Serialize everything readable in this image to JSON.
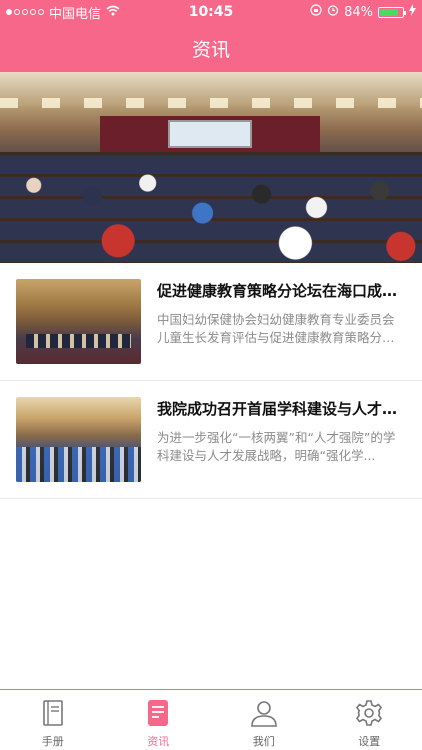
{
  "status_bar": {
    "carrier": "中国电信",
    "time": "10:45",
    "battery_percent": "84%",
    "battery_level": 0.84,
    "signal_dots_filled": 1,
    "signal_dots_total": 5
  },
  "nav": {
    "title": "资讯"
  },
  "banner": {
    "slide_count": 2,
    "active_slide": 1
  },
  "news": [
    {
      "title": "促进健康教育策略分论坛在海口成功...",
      "desc": "中国妇幼保健协会妇幼健康教育专业委员会儿童生长发育评估与促进健康教育策略分论...",
      "thumb": "conference-hall-photo"
    },
    {
      "title": "我院成功召开首届学科建设与人才工...",
      "desc": "为进一步强化“一核两翼”和“人才强院”的学科建设与人才发展战略，明确“强化学...",
      "thumb": "meeting-room-photo"
    }
  ],
  "tabs": [
    {
      "label": "手册",
      "icon": "book-icon",
      "active": false
    },
    {
      "label": "资讯",
      "icon": "news-icon",
      "active": true
    },
    {
      "label": "我们",
      "icon": "person-icon",
      "active": false
    },
    {
      "label": "设置",
      "icon": "gear-icon",
      "active": false
    }
  ],
  "colors": {
    "brand": "#f7678a",
    "battery": "#4cd964"
  }
}
